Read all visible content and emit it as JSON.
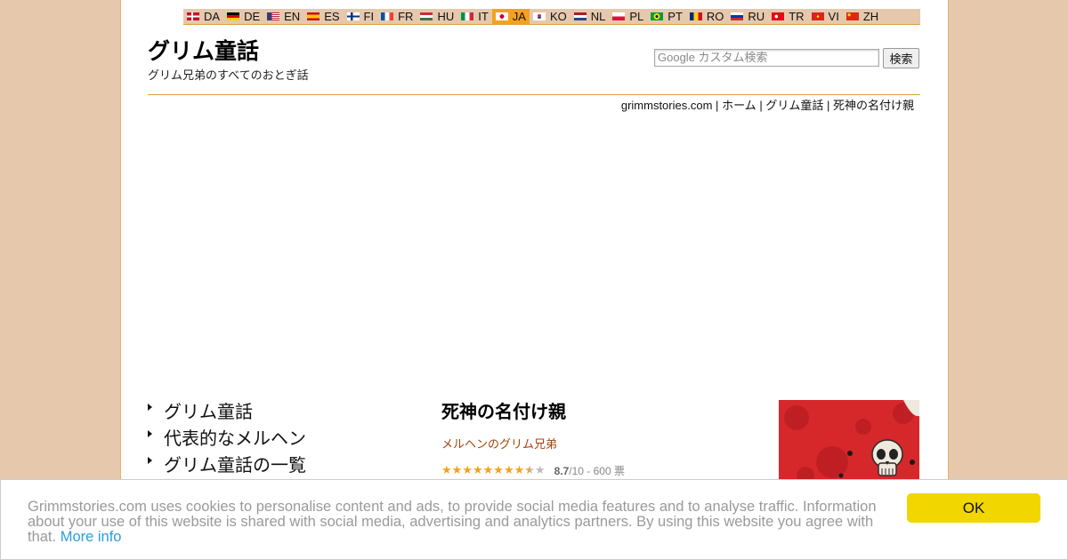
{
  "languages": [
    {
      "code": "DA",
      "flag": "flag-denmark-icon",
      "colors": [
        "#c8102e",
        "#ffffff"
      ],
      "active": false
    },
    {
      "code": "DE",
      "flag": "flag-germany-icon",
      "colors": [
        "#000000",
        "#dd0000",
        "#ffce00"
      ],
      "active": false
    },
    {
      "code": "EN",
      "flag": "flag-usa-icon",
      "colors": [
        "#b22234",
        "#ffffff",
        "#3c3b6e"
      ],
      "active": false
    },
    {
      "code": "ES",
      "flag": "flag-spain-icon",
      "colors": [
        "#c60b1e",
        "#ffc400"
      ],
      "active": false
    },
    {
      "code": "FI",
      "flag": "flag-finland-icon",
      "colors": [
        "#ffffff",
        "#003580"
      ],
      "active": false
    },
    {
      "code": "FR",
      "flag": "flag-france-icon",
      "colors": [
        "#0055a4",
        "#ffffff",
        "#ef4135"
      ],
      "active": false
    },
    {
      "code": "HU",
      "flag": "flag-hungary-icon",
      "colors": [
        "#cd2a3e",
        "#ffffff",
        "#436f4d"
      ],
      "active": false
    },
    {
      "code": "IT",
      "flag": "flag-italy-icon",
      "colors": [
        "#009246",
        "#ffffff",
        "#ce2b37"
      ],
      "active": false
    },
    {
      "code": "JA",
      "flag": "flag-japan-icon",
      "colors": [
        "#ffffff",
        "#bc002d"
      ],
      "active": true
    },
    {
      "code": "KO",
      "flag": "flag-korea-icon",
      "colors": [
        "#ffffff",
        "#cd2e3a",
        "#0047a0"
      ],
      "active": false
    },
    {
      "code": "NL",
      "flag": "flag-netherlands-icon",
      "colors": [
        "#ae1c28",
        "#ffffff",
        "#21468b"
      ],
      "active": false
    },
    {
      "code": "PL",
      "flag": "flag-poland-icon",
      "colors": [
        "#ffffff",
        "#dc143c"
      ],
      "active": false
    },
    {
      "code": "PT",
      "flag": "flag-brazil-icon",
      "colors": [
        "#009c3b",
        "#ffdf00",
        "#002776"
      ],
      "active": false
    },
    {
      "code": "RO",
      "flag": "flag-romania-icon",
      "colors": [
        "#002b7f",
        "#fcd116",
        "#ce1126"
      ],
      "active": false
    },
    {
      "code": "RU",
      "flag": "flag-russia-icon",
      "colors": [
        "#ffffff",
        "#0039a6",
        "#d52b1e"
      ],
      "active": false
    },
    {
      "code": "TR",
      "flag": "flag-turkey-icon",
      "colors": [
        "#e30a17",
        "#ffffff"
      ],
      "active": false
    },
    {
      "code": "VI",
      "flag": "flag-vietnam-icon",
      "colors": [
        "#da251d",
        "#ffff00"
      ],
      "active": false
    },
    {
      "code": "ZH",
      "flag": "flag-china-icon",
      "colors": [
        "#de2910",
        "#ffde00"
      ],
      "active": false
    }
  ],
  "header": {
    "title": "グリム童話",
    "subtitle": "グリム兄弟のすべてのおとぎ話"
  },
  "search": {
    "placeholder": "Google カスタム検索",
    "button_label": "検索"
  },
  "breadcrumb": {
    "site": "grimmstories.com",
    "home": "ホーム",
    "section": "グリム童話",
    "current": "死神の名付け親",
    "separator": "|"
  },
  "nav": {
    "items": [
      "グリム童話",
      "代表的なメルヘン",
      "グリム童話の一覧"
    ]
  },
  "story": {
    "title": "死神の名付け親",
    "author_line": "メルヘンのグリム兄弟",
    "rating_score": "8.7",
    "rating_rest": "/10 - 600 票",
    "rating_value": 8.7,
    "rating_max": 10
  },
  "cookie": {
    "text": "Grimmstories.com uses cookies to personalise content and ads, to provide social media features and to analyse traffic. Information about your use of this website is shared with social media, advertising and analytics partners. By using this website you agree with that.",
    "more_info": "More info",
    "ok_label": "OK"
  },
  "colors": {
    "background": "#e6c8ad",
    "accent": "#f4a21d",
    "border": "#e0a040",
    "author_link": "#a0440c",
    "star": "#f2a21a",
    "cookie_link": "#2a9fd8",
    "ok_button": "#f1d600"
  }
}
